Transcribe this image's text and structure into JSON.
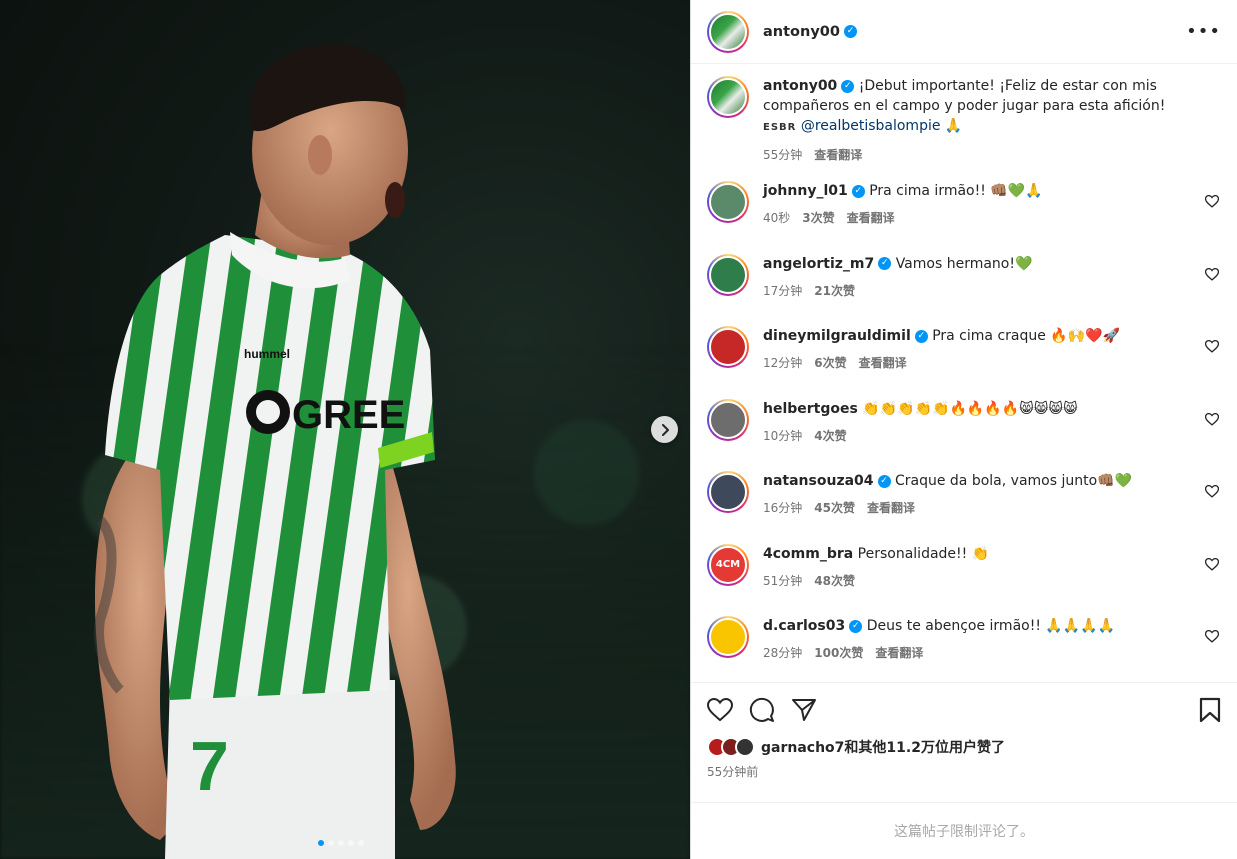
{
  "post": {
    "author": "antony00",
    "caption": {
      "text": "¡Debut importante! ¡Feliz de estar con mis compañeros en el campo y poder jugar para esta afición!",
      "tag": "ESBR",
      "mention": "@realbetisbalompie",
      "emoji": "🙏",
      "time": "55分钟",
      "translate": "查看翻译"
    },
    "comments": [
      {
        "user": "johnny_l01",
        "verified": true,
        "text": "Pra cima irmão!! 👊🏽💚🙏",
        "time": "40秒",
        "likes": "3次赞",
        "translate": "查看翻译",
        "avatar_color": "#5a8a6a"
      },
      {
        "user": "angelortiz_m7",
        "verified": true,
        "text": "Vamos hermano!💚",
        "time": "17分钟",
        "likes": "21次赞",
        "translate": "",
        "avatar_color": "#2e7d4a"
      },
      {
        "user": "dineymilgrauldimil",
        "verified": true,
        "text": "Pra cima craque 🔥🙌❤️🚀",
        "time": "12分钟",
        "likes": "6次赞",
        "translate": "查看翻译",
        "avatar_color": "#c62828"
      },
      {
        "user": "helbertgoes",
        "verified": false,
        "text": "👏👏👏👏👏🔥🔥🔥🔥😸😸😸😸",
        "time": "10分钟",
        "likes": "4次赞",
        "translate": "",
        "avatar_color": "#6d6d6d"
      },
      {
        "user": "natansouza04",
        "verified": true,
        "text": "Craque da bola, vamos junto👊🏽💚",
        "time": "16分钟",
        "likes": "45次赞",
        "translate": "查看翻译",
        "avatar_color": "#3e4a5c"
      },
      {
        "user": "4comm_bra",
        "verified": false,
        "text": "Personalidade!! 👏",
        "time": "51分钟",
        "likes": "48次赞",
        "translate": "",
        "avatar_color": "#e53935",
        "avatar_text": "4CM"
      },
      {
        "user": "d.carlos03",
        "verified": true,
        "text": "Deus te abençoe irmão!! 🙏🙏🙏🙏",
        "time": "28分钟",
        "likes": "100次赞",
        "translate": "查看翻译",
        "avatar_color": "#f9c400"
      }
    ],
    "likes_text": "garnacho7和其他11.2万位用户赞了",
    "likes_user": "garnacho7",
    "likes_rest": "和其他11.2万位用户赞了",
    "posted_time": "55分钟前",
    "restricted": "这篇帖子限制评论了。"
  },
  "icons": {
    "more": "more-options-icon",
    "like": "heart-icon",
    "comment": "comment-icon",
    "share": "share-icon",
    "save": "bookmark-icon",
    "next": "chevron-right-icon"
  },
  "colors": {
    "verified": "#0095f6",
    "meta": "#737373",
    "border": "#dbdbdb",
    "betis_green": "#1f8f3a"
  },
  "carousel": {
    "count": 5,
    "active": 0
  },
  "media": {
    "sponsor_text": "GREE",
    "kit_brand": "hummel",
    "shorts_number": "7"
  }
}
